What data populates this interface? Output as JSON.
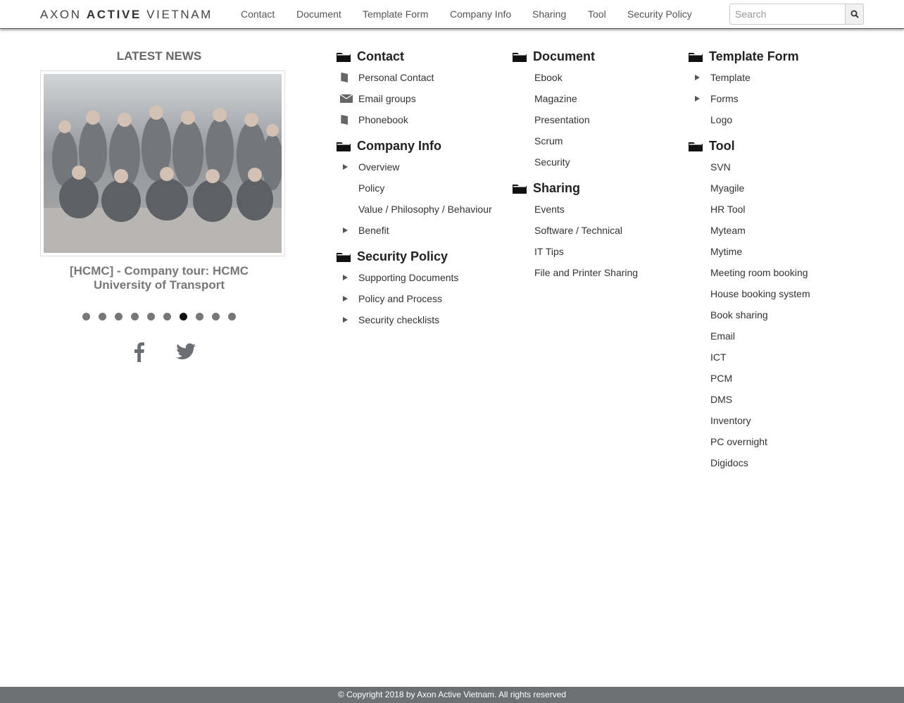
{
  "brand": {
    "light": "AXON ",
    "bold": "ACTIVE",
    "light2": " VIETNAM"
  },
  "nav": [
    "Contact",
    "Document",
    "Template Form",
    "Company Info",
    "Sharing",
    "Tool",
    "Security Policy"
  ],
  "search": {
    "placeholder": "Search",
    "icon": "search-icon"
  },
  "news": {
    "title": "LATEST NEWS",
    "caption": "[HCMC] - Company tour: HCMC University of Transport",
    "slide_count": 10,
    "active_slide": 7
  },
  "social": [
    "facebook-icon",
    "twitter-icon"
  ],
  "columns": [
    [
      {
        "title": "Contact",
        "links": [
          {
            "label": "Personal Contact",
            "icon": "book"
          },
          {
            "label": "Email groups",
            "icon": "envelope"
          },
          {
            "label": "Phonebook",
            "icon": "book"
          }
        ]
      },
      {
        "title": "Company Info",
        "links": [
          {
            "label": "Overview",
            "icon": "triangle"
          },
          {
            "label": "Policy",
            "icon": ""
          },
          {
            "label": "Value / Philosophy / Behaviour",
            "icon": ""
          },
          {
            "label": "Benefit",
            "icon": "triangle"
          }
        ]
      },
      {
        "title": "Security Policy",
        "links": [
          {
            "label": "Supporting Documents",
            "icon": "triangle"
          },
          {
            "label": "Policy and Process",
            "icon": "triangle"
          },
          {
            "label": "Security checklists",
            "icon": "triangle"
          }
        ]
      }
    ],
    [
      {
        "title": "Document",
        "links": [
          {
            "label": "Ebook",
            "icon": ""
          },
          {
            "label": "Magazine",
            "icon": ""
          },
          {
            "label": "Presentation",
            "icon": ""
          },
          {
            "label": "Scrum",
            "icon": ""
          },
          {
            "label": "Security",
            "icon": ""
          }
        ]
      },
      {
        "title": "Sharing",
        "links": [
          {
            "label": "Events",
            "icon": ""
          },
          {
            "label": "Software / Technical",
            "icon": ""
          },
          {
            "label": "IT Tips",
            "icon": ""
          },
          {
            "label": "File and Printer Sharing",
            "icon": ""
          }
        ]
      }
    ],
    [
      {
        "title": "Template Form",
        "links": [
          {
            "label": "Template",
            "icon": "triangle"
          },
          {
            "label": "Forms",
            "icon": "triangle"
          },
          {
            "label": "Logo",
            "icon": ""
          }
        ]
      },
      {
        "title": "Tool",
        "links": [
          {
            "label": "SVN",
            "icon": ""
          },
          {
            "label": "Myagile",
            "icon": ""
          },
          {
            "label": "HR Tool",
            "icon": ""
          },
          {
            "label": "Myteam",
            "icon": ""
          },
          {
            "label": "Mytime",
            "icon": ""
          },
          {
            "label": "Meeting room booking",
            "icon": ""
          },
          {
            "label": "House booking system",
            "icon": ""
          },
          {
            "label": "Book sharing",
            "icon": ""
          },
          {
            "label": "Email",
            "icon": ""
          },
          {
            "label": "ICT",
            "icon": ""
          },
          {
            "label": "PCM",
            "icon": ""
          },
          {
            "label": "DMS",
            "icon": ""
          },
          {
            "label": "Inventory",
            "icon": ""
          },
          {
            "label": "PC overnight",
            "icon": ""
          },
          {
            "label": "Digidocs",
            "icon": ""
          }
        ]
      }
    ]
  ],
  "footer": "© Copyright 2018 by Axon Active Vietnam. All rights reserved"
}
